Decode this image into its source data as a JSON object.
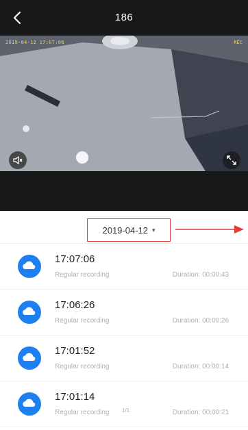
{
  "header": {
    "title": "186"
  },
  "video": {
    "osd_left": "2019-04-12 17:07:06",
    "osd_right": "REC",
    "mute_icon": "speaker-muted-icon",
    "fullscreen_icon": "fullscreen-icon"
  },
  "date_picker": {
    "value": "2019-04-12",
    "caret": "▾"
  },
  "recordings": [
    {
      "time": "17:07:06",
      "type": "Regular recording",
      "duration": "Duration: 00:00:43"
    },
    {
      "time": "17:06:26",
      "type": "Regular recording",
      "duration": "Duration: 00:00:26"
    },
    {
      "time": "17:01:52",
      "type": "Regular recording",
      "duration": "Duration: 00:00:14"
    },
    {
      "time": "17:01:14",
      "type": "Regular recording",
      "duration": "Duration: 00:00:21"
    }
  ],
  "page_indicator": "1/1",
  "colors": {
    "topbar": "#17181a",
    "accent_blue": "#1e7ff0",
    "highlight_red": "#e03c3c"
  }
}
